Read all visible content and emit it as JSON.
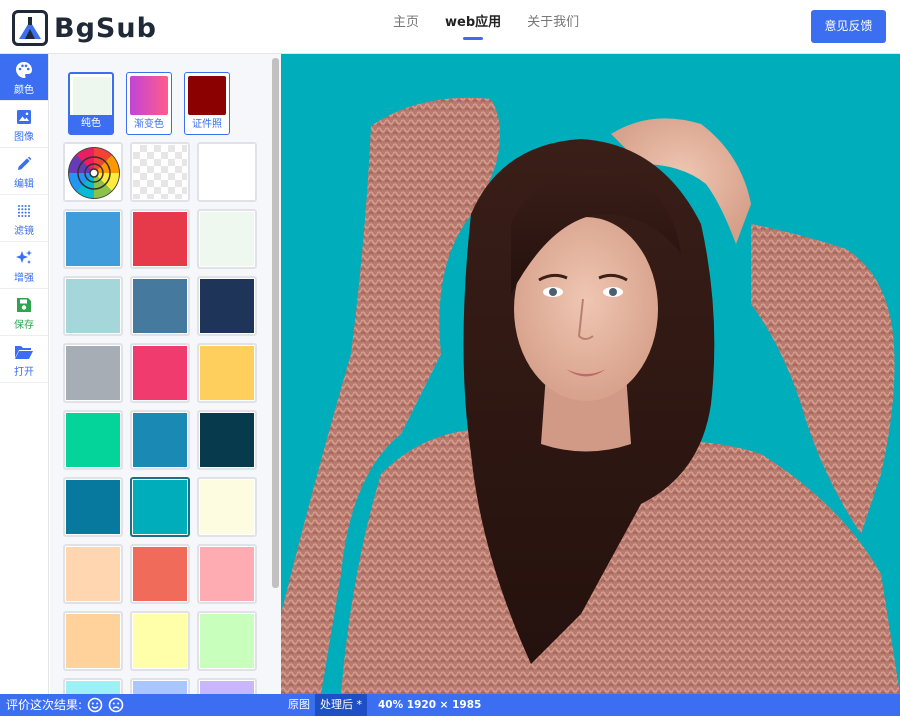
{
  "header": {
    "logo_text": "BgSub",
    "nav": [
      {
        "label": "主页",
        "active": false
      },
      {
        "label": "web应用",
        "active": true
      },
      {
        "label": "关于我们",
        "active": false
      }
    ],
    "feedback_label": "意见反馈"
  },
  "tools": [
    {
      "label": "颜色",
      "icon": "palette-icon",
      "active": true
    },
    {
      "label": "图像",
      "icon": "image-icon",
      "active": false
    },
    {
      "label": "编辑",
      "icon": "pencil-icon",
      "active": false
    },
    {
      "label": "滤镜",
      "icon": "filter-dots-icon",
      "active": false
    },
    {
      "label": "增强",
      "icon": "sparkle-icon",
      "active": false
    },
    {
      "label": "保存",
      "icon": "save-icon",
      "active": false
    },
    {
      "label": "打开",
      "icon": "folder-open-icon",
      "active": false
    }
  ],
  "panel": {
    "tabs": [
      {
        "label": "纯色",
        "color": "#eef7ee",
        "active": true
      },
      {
        "label": "渐变色",
        "color": "linear-gradient(90deg,#c044d8,#ff5c8a)",
        "active": false
      },
      {
        "label": "证件照",
        "color": "#8b0000",
        "active": false
      }
    ],
    "special": [
      "color-wheel",
      "transparent",
      "#ffffff"
    ],
    "colors": [
      "#3f9ddb",
      "#e63a4a",
      "#eef8ee",
      "#a5d7da",
      "#457a9e",
      "#1e3559",
      "#a6adb5",
      "#f03b6e",
      "#ffcf5e",
      "#04d39a",
      "#1a8ab5",
      "#083a4d",
      "#07799f",
      "#00aebb",
      "#fdfbe0",
      "#ffd6b0",
      "#f06b5a",
      "#ffabb2",
      "#ffd29b",
      "#feffa8",
      "#c8ffbd",
      "#9ef0f7",
      "#a8c6ff",
      "#c8b6ff"
    ],
    "selected_index": 13
  },
  "canvas": {
    "background": "#00aebb"
  },
  "footer": {
    "rate_label": "评价这次结果:",
    "view_original": "原图",
    "view_processed": "处理后 *",
    "info": "40% 1920 × 1985"
  }
}
